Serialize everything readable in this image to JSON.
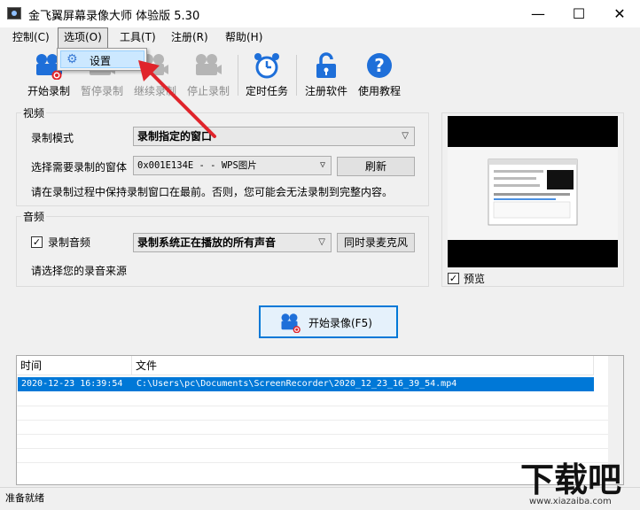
{
  "window": {
    "title": "金飞翼屏幕录像大师 体验版 5.30",
    "minimize_glyph": "—",
    "maximize_glyph": "☐",
    "close_glyph": "✕"
  },
  "menubar": {
    "items": [
      {
        "label": "控制(C)"
      },
      {
        "label": "选项(O)"
      },
      {
        "label": "工具(T)"
      },
      {
        "label": "注册(R)"
      },
      {
        "label": "帮助(H)"
      }
    ],
    "dropdown": {
      "items": [
        {
          "label": "设置",
          "icon": "gear-icon"
        }
      ]
    }
  },
  "toolbar": {
    "start_record": "开始录制",
    "pause_record": "暂停录制",
    "continue_record": "继续录制",
    "stop_record": "停止录制",
    "scheduled_task": "定时任务",
    "register": "注册软件",
    "tutorial": "使用教程"
  },
  "video": {
    "group_title": "视频",
    "mode_label": "录制模式",
    "mode_value": "录制指定的窗口",
    "window_label": "选择需要录制的窗体",
    "window_value": "0x001E134E -  - WPS图片",
    "refresh_button": "刷新",
    "hint": "请在录制过程中保持录制窗口在最前。否则，您可能会无法录制到完整内容。"
  },
  "audio": {
    "group_title": "音频",
    "record_audio_label": "录制音频",
    "record_audio_checked": true,
    "source_value": "录制系统正在播放的所有声音",
    "mic_button": "同时录麦克风",
    "hint": "请选择您的录音来源"
  },
  "preview": {
    "label": "预览",
    "checked": true
  },
  "start_button": {
    "label": "开始录像(F5)"
  },
  "list": {
    "columns": [
      "时间",
      "文件"
    ],
    "rows": [
      {
        "time": "2020-12-23 16:39:54",
        "file": "C:\\Users\\pc\\Documents\\ScreenRecorder\\2020_12_23_16_39_54.mp4"
      }
    ]
  },
  "status": {
    "text": "准备就绪"
  },
  "watermark": {
    "brand": "下载吧",
    "url": "www.xiazaiba.com"
  },
  "colors": {
    "selection": "#0078d7",
    "accent_blue": "#1e6fd9",
    "red": "#e0242b"
  }
}
